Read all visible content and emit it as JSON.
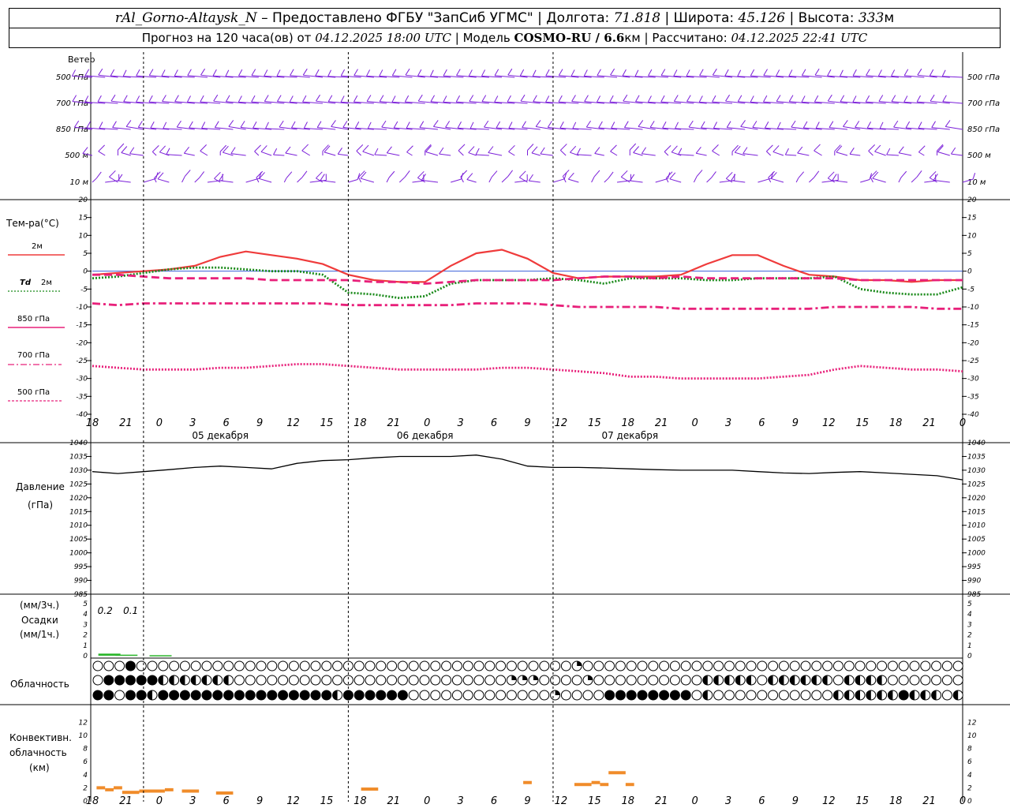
{
  "header": {
    "station": "rAl_Gorno-Altaysk_N",
    "provided_prefix": "– Предоставлено ФГБУ \"ЗапСиб УГМС\" |",
    "lon_label": "Долгота:",
    "lon_value": "71.818",
    "lat_label": "| Широта:",
    "lat_value": "45.126",
    "alt_label": "| Высота:",
    "alt_value": "333",
    "alt_unit": "м",
    "forecast_prefix": "Прогноз на 120 часа(ов) от",
    "forecast_from": "04.12.2025 18:00 UTC",
    "model_label": "| Модель",
    "model_name": "COSMO-RU / 6.6",
    "model_unit": "км",
    "calc_label": "| Рассчитано:",
    "calc_value": "04.12.2025 22:41 UTC"
  },
  "chart_data": [
    {
      "type": "barbs",
      "title": "Ветер",
      "levels": [
        "500 гПа",
        "700 гПа",
        "850 гПа",
        "500 м",
        "10 м"
      ],
      "barb_color": "#7b1fd9",
      "note": "Wind barbs every 3 hours; predominantly westerly aloft, variable/weak near surface."
    },
    {
      "type": "line",
      "title": "Тем-ра(°C)",
      "ylim": [
        -40,
        20
      ],
      "yticks": [
        20,
        15,
        10,
        5,
        0,
        -5,
        -10,
        -15,
        -20,
        -25,
        -30,
        -35,
        -40
      ],
      "x_hours": [
        18,
        21,
        24,
        27,
        30,
        33,
        36,
        39,
        42,
        45,
        48,
        51,
        54,
        57,
        60,
        63,
        66,
        69,
        72,
        75,
        78,
        81,
        84,
        87,
        90,
        93,
        96,
        99,
        102,
        105,
        108,
        111,
        114,
        117,
        120
      ],
      "series": [
        {
          "name": "2м",
          "color": "#ef3b3b",
          "style": "solid",
          "values": [
            -1,
            -0.5,
            0,
            0.5,
            1.5,
            4,
            5.5,
            4.5,
            3.5,
            2,
            -1,
            -2.5,
            -3,
            -3,
            1.5,
            5,
            6,
            3.5,
            -0.5,
            -2,
            -1.5,
            -1.5,
            -1.5,
            -1,
            2,
            4.5,
            4.5,
            1.5,
            -1,
            -1.5,
            -2.5,
            -2.5,
            -3,
            -2.5,
            -2.5
          ]
        },
        {
          "name": "Td 2м",
          "color": "#1a8a1a",
          "style": "dotted",
          "values": [
            -2,
            -1.5,
            -0.5,
            0.5,
            1,
            1,
            0.5,
            0,
            0,
            -1,
            -6,
            -6.5,
            -7.5,
            -7,
            -3.5,
            -2.5,
            -2.5,
            -2.5,
            -2,
            -2.5,
            -3.5,
            -2,
            -2,
            -2,
            -2.5,
            -2.5,
            -2,
            -2,
            -2,
            -1.5,
            -5,
            -6,
            -6.5,
            -6.5,
            -4.5
          ]
        },
        {
          "name": "850 гПа",
          "color": "#e8207a",
          "style": "dashed",
          "values": [
            -1,
            -1,
            -1.5,
            -2,
            -2,
            -2,
            -2,
            -2.5,
            -2.5,
            -2.5,
            -2.5,
            -3,
            -3,
            -3.5,
            -3,
            -2.5,
            -2.5,
            -2.5,
            -2.5,
            -2,
            -1.5,
            -1.5,
            -2,
            -1.5,
            -2,
            -2,
            -2,
            -2,
            -2,
            -2,
            -2.5,
            -2.5,
            -2.5,
            -2.5,
            -2.5
          ]
        },
        {
          "name": "700 гПа",
          "color": "#e8207a",
          "style": "dashdot",
          "values": [
            -9,
            -9.5,
            -9,
            -9,
            -9,
            -9,
            -9,
            -9,
            -9,
            -9,
            -9.5,
            -9.5,
            -9.5,
            -9.5,
            -9.5,
            -9,
            -9,
            -9,
            -9.5,
            -10,
            -10,
            -10,
            -10,
            -10.5,
            -10.5,
            -10.5,
            -10.5,
            -10.5,
            -10.5,
            -10,
            -10,
            -10,
            -10,
            -10.5,
            -10.5
          ]
        },
        {
          "name": "500 гПа",
          "color": "#e8207a",
          "style": "dotted",
          "values": [
            -26.5,
            -27,
            -27.5,
            -27.5,
            -27.5,
            -27,
            -27,
            -26.5,
            -26,
            -26,
            -26.5,
            -27,
            -27.5,
            -27.5,
            -27.5,
            -27.5,
            -27,
            -27,
            -27.5,
            -28,
            -28.5,
            -29.5,
            -29.5,
            -30,
            -30,
            -30,
            -30,
            -29.5,
            -29,
            -27.5,
            -26.5,
            -27,
            -27.5,
            -27.5,
            -28
          ]
        }
      ]
    },
    {
      "type": "line",
      "title": "Давление",
      "unit": "(гПа)",
      "ylim": [
        985,
        1040
      ],
      "yticks": [
        1040,
        1035,
        1030,
        1025,
        1020,
        1015,
        1010,
        1005,
        1000,
        995,
        990,
        985
      ],
      "x_hours": [
        18,
        21,
        24,
        27,
        30,
        33,
        36,
        39,
        42,
        45,
        48,
        51,
        54,
        57,
        60,
        63,
        66,
        69,
        72,
        75,
        78,
        81,
        84,
        87,
        90,
        93,
        96,
        99,
        102,
        105,
        108,
        111,
        114,
        117,
        120
      ],
      "series": [
        {
          "name": "pressure",
          "color": "#000000",
          "style": "solid",
          "values": [
            1029.5,
            1028.8,
            1029.5,
            1030.2,
            1031,
            1031.5,
            1031,
            1030.5,
            1032.5,
            1033.5,
            1033.8,
            1034.5,
            1035,
            1035,
            1035,
            1035.5,
            1034,
            1031.5,
            1031,
            1031,
            1030.8,
            1030.5,
            1030.2,
            1030,
            1030,
            1030,
            1029.5,
            1029,
            1028.8,
            1029.2,
            1029.5,
            1029,
            1028.5,
            1028,
            1026.5
          ]
        }
      ]
    },
    {
      "type": "bar",
      "title": "Осадки",
      "unit_top": "(мм/3ч.)",
      "unit_bottom": "(мм/1ч.)",
      "ylim": [
        0,
        5
      ],
      "yticks": [
        5,
        4,
        3,
        2,
        1,
        0
      ],
      "annotations": [
        {
          "label": "0.2",
          "hour": 19.5
        },
        {
          "label": "0.1",
          "hour": 22.5
        }
      ],
      "bars": [
        {
          "hour": 20,
          "value": 0.2
        },
        {
          "hour": 22,
          "value": 0.1
        },
        {
          "hour": 26,
          "value": 0.05
        }
      ]
    },
    {
      "type": "symbols",
      "title": "Облачность",
      "note": "Cloud cover symbols in three rows (high / middle / low), one per hour."
    },
    {
      "type": "bar",
      "title": "Конвективн. облачность (км)",
      "label_lines": [
        "Конвективн.",
        "облачность",
        "(км)"
      ],
      "ylim": [
        0,
        13
      ],
      "yticks": [
        12,
        10,
        8,
        6,
        4,
        2,
        0
      ],
      "color": "#f08c2a",
      "segments": [
        {
          "start": 18.5,
          "end": 19.5,
          "value": 2.0
        },
        {
          "start": 19.5,
          "end": 20.5,
          "value": 1.7
        },
        {
          "start": 20.5,
          "end": 21.5,
          "value": 2.0
        },
        {
          "start": 21.5,
          "end": 23.5,
          "value": 1.3
        },
        {
          "start": 23.5,
          "end": 26.5,
          "value": 1.5
        },
        {
          "start": 26.5,
          "end": 27.5,
          "value": 1.7
        },
        {
          "start": 28.5,
          "end": 30.5,
          "value": 1.5
        },
        {
          "start": 32.5,
          "end": 34.5,
          "value": 1.2
        },
        {
          "start": 49.5,
          "end": 51.5,
          "value": 1.8
        },
        {
          "start": 68.5,
          "end": 69.5,
          "value": 2.8
        },
        {
          "start": 74.5,
          "end": 76.5,
          "value": 2.5
        },
        {
          "start": 76.5,
          "end": 77.5,
          "value": 2.8
        },
        {
          "start": 77.5,
          "end": 78.5,
          "value": 2.5
        },
        {
          "start": 78.5,
          "end": 80.5,
          "value": 4.3
        },
        {
          "start": 80.5,
          "end": 81.5,
          "value": 2.5
        }
      ]
    }
  ],
  "x_axis": {
    "hour_labels": [
      "18",
      "21",
      "0",
      "3",
      "6",
      "9",
      "12",
      "15",
      "18",
      "21",
      "0",
      "3",
      "6",
      "9",
      "12",
      "15",
      "18",
      "21",
      "0",
      "3",
      "6",
      "9",
      "12",
      "15",
      "18",
      "21",
      "0"
    ],
    "day_labels": [
      {
        "label": "05 декабря",
        "hour": 33
      },
      {
        "label": "06 декабря",
        "hour": 57
      },
      {
        "label": "07 декабря",
        "hour": 81
      }
    ]
  },
  "legend": {
    "t2m": "2м",
    "td_italic": "Td",
    "td_suffix": "2м",
    "t850": "850 гПа",
    "t700": "700 гПа",
    "t500": "500 гПа"
  },
  "wind_row_labels": [
    "500 гПа",
    "700 гПа",
    "850 гПа",
    "500 м",
    "10 м"
  ]
}
